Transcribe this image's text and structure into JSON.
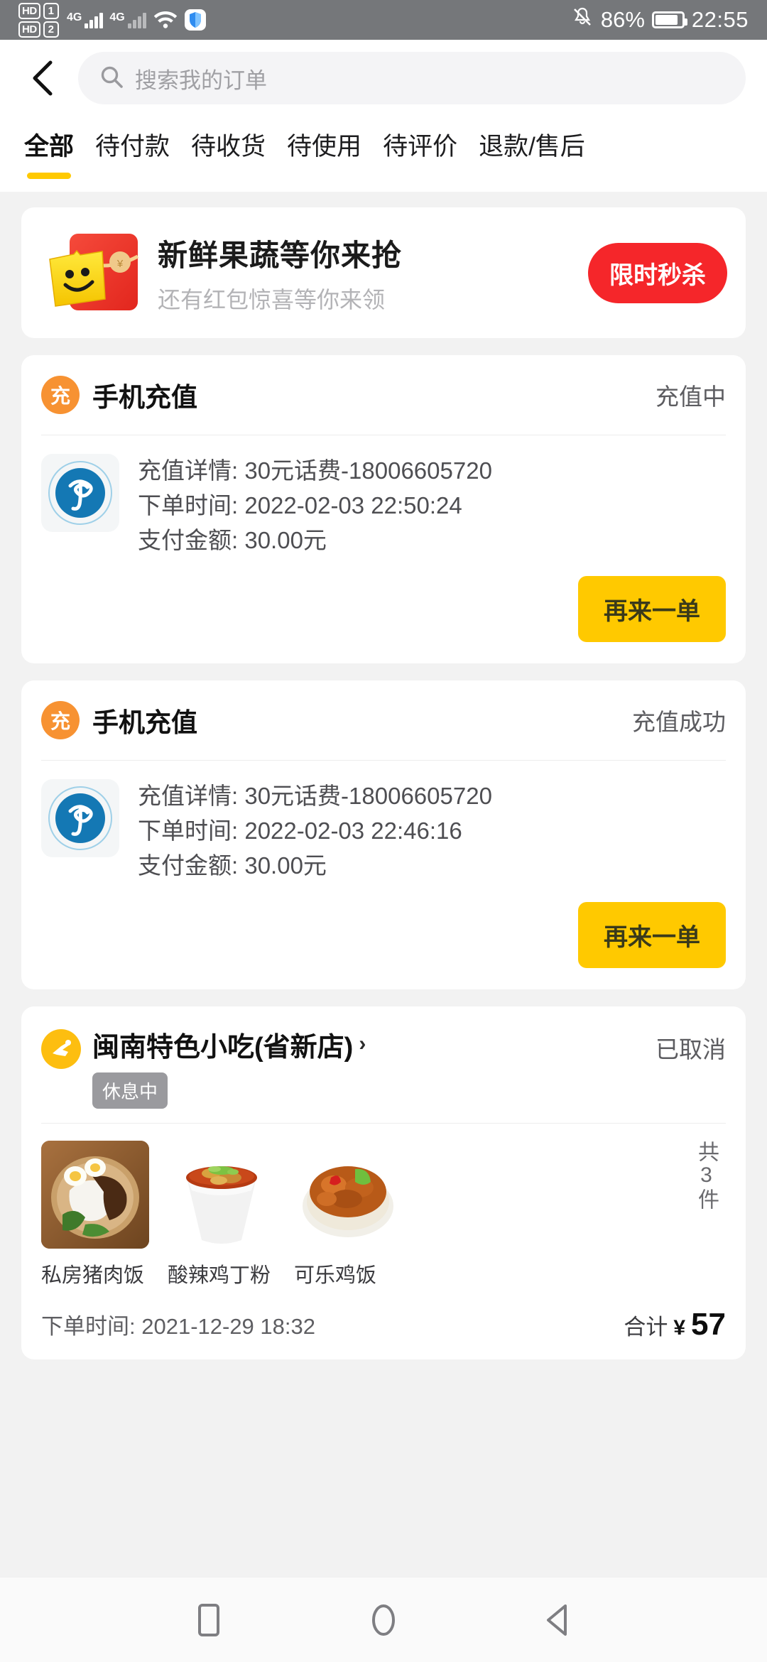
{
  "statusbar": {
    "hd1_label": "HD",
    "hd1_num": "1",
    "hd2_label": "HD",
    "hd2_num": "2",
    "net1": "4G",
    "net2": "4G",
    "wifi_icon": "wifi-icon",
    "shield_icon": "shield-icon",
    "mute_icon": "bell-muted-icon",
    "battery_percent": "86%",
    "clock": "22:55"
  },
  "header": {
    "back_icon": "chevron-left-icon",
    "search_icon": "search-icon",
    "search_value": "",
    "search_placeholder": "搜索我的订单"
  },
  "tabs": [
    {
      "label": "全部",
      "active": true
    },
    {
      "label": "待付款",
      "active": false
    },
    {
      "label": "待收货",
      "active": false
    },
    {
      "label": "待使用",
      "active": false
    },
    {
      "label": "待评价",
      "active": false
    },
    {
      "label": "退款/售后",
      "active": false
    }
  ],
  "banner": {
    "icon": "red-envelope-icon",
    "title": "新鲜果蔬等你来抢",
    "subtitle": "还有红包惊喜等你来领",
    "button_label": "限时秒杀",
    "button_color": "#f5262a"
  },
  "orders": [
    {
      "type": "recharge",
      "icon_label": "充",
      "icon_color": "#f79232",
      "title": "手机充值",
      "status": "充值中",
      "logo_icon": "china-telecom-logo",
      "detail_label": "充值详情: 30元话费-18006605720",
      "time_label": "下单时间: 2022-02-03 22:50:24",
      "amount_label": "支付金额: 30.00元",
      "action_label": "再来一单"
    },
    {
      "type": "recharge",
      "icon_label": "充",
      "icon_color": "#f79232",
      "title": "手机充值",
      "status": "充值成功",
      "logo_icon": "china-telecom-logo",
      "detail_label": "充值详情: 30元话费-18006605720",
      "time_label": "下单时间: 2022-02-03 22:46:16",
      "amount_label": "支付金额: 30.00元",
      "action_label": "再来一单"
    }
  ],
  "shop_order": {
    "icon": "delivery-rider-icon",
    "icon_color": "#fdbe10",
    "shop_name": "闽南特色小吃(省新店)",
    "chevron": "›",
    "rest_badge": "休息中",
    "status": "已取消",
    "items": [
      {
        "name": "私房猪肉饭",
        "image": "pork-rice-bowl-photo"
      },
      {
        "name": "酸辣鸡丁粉",
        "image": "hot-sour-chicken-noodle-photo"
      },
      {
        "name": "可乐鸡饭",
        "image": "cola-chicken-rice-photo"
      }
    ],
    "count_text": "共3件",
    "order_time": "下单时间: 2021-12-29 18:32",
    "total_label": "合计",
    "currency": "¥",
    "total_value": "57"
  },
  "navbar": {
    "recents_icon": "square-recents-icon",
    "home_icon": "circle-home-icon",
    "back_icon": "triangle-back-icon"
  }
}
